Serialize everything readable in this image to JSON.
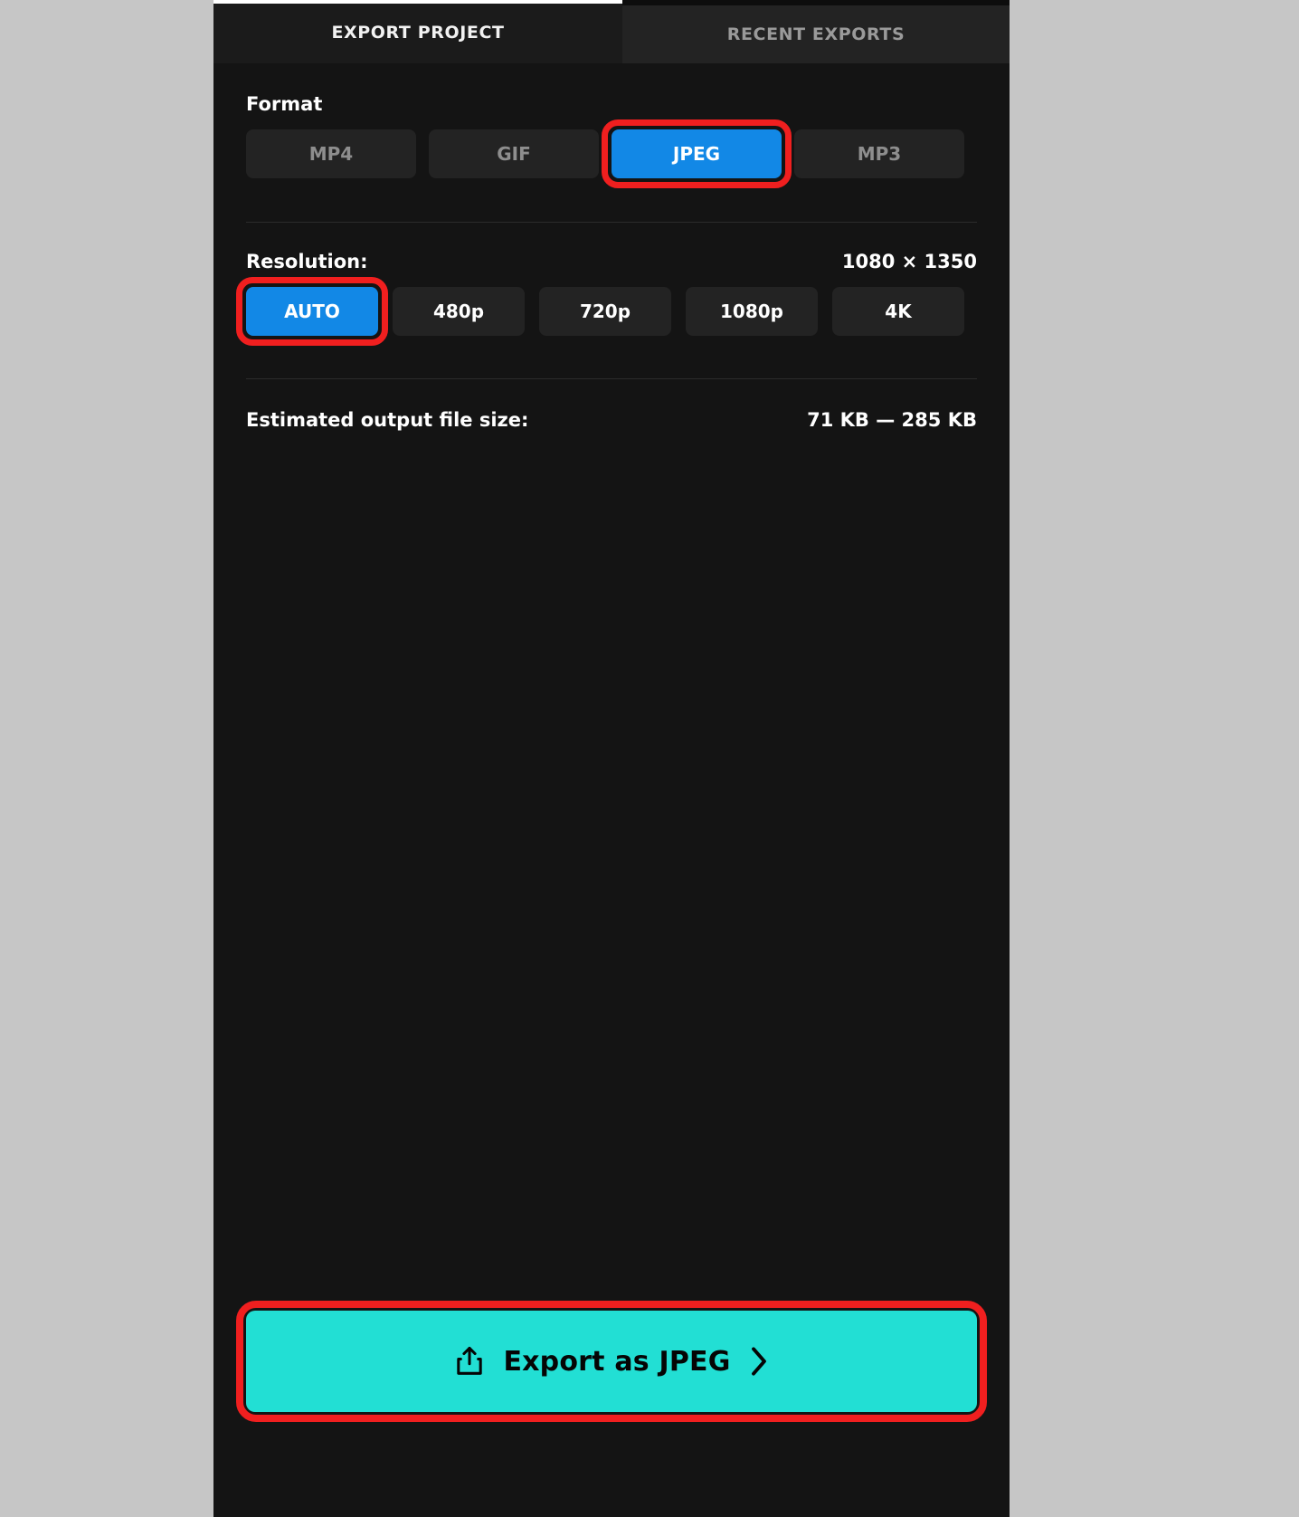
{
  "window": {
    "outside_background": "#c6c6c6",
    "panel_background": "#141414"
  },
  "tabs": [
    {
      "label": "EXPORT PROJECT",
      "active": true
    },
    {
      "label": "RECENT EXPORTS",
      "active": false
    }
  ],
  "format": {
    "label": "Format",
    "options": [
      {
        "label": "MP4",
        "selected": false
      },
      {
        "label": "GIF",
        "selected": false
      },
      {
        "label": "JPEG",
        "selected": true,
        "highlighted": true
      },
      {
        "label": "MP3",
        "selected": false
      }
    ]
  },
  "resolution": {
    "label": "Resolution:",
    "value": "1080 × 1350",
    "options": [
      {
        "label": "AUTO",
        "selected": true,
        "highlighted": true
      },
      {
        "label": "480p",
        "selected": false
      },
      {
        "label": "720p",
        "selected": false
      },
      {
        "label": "1080p",
        "selected": false
      },
      {
        "label": "4K",
        "selected": false
      }
    ]
  },
  "file_size": {
    "label": "Estimated output file size:",
    "value": "71 KB — 285 KB"
  },
  "export_action": {
    "label": "Export as JPEG",
    "icon": "share-upload-icon",
    "trailing_icon": "chevron-right-icon",
    "highlighted": true
  },
  "colors": {
    "accent_blue": "#1288e6",
    "accent_teal": "#22dfd4",
    "highlight_red": "#f01f1f",
    "button_dark": "#232323",
    "panel": "#141414",
    "tab_active": "#1b1b1b",
    "tab_inactive": "#232323",
    "text_primary": "#ffffff",
    "text_muted": "#8e8e8e"
  }
}
